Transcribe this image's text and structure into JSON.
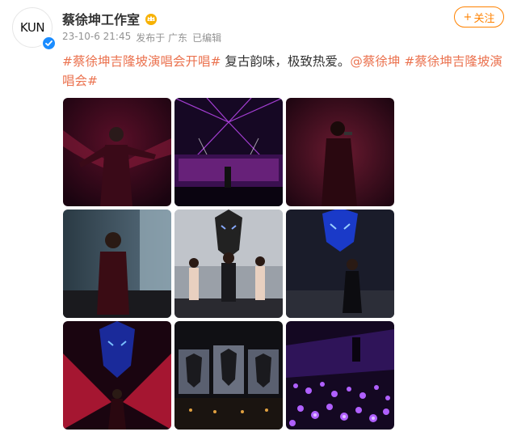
{
  "user": {
    "name": "蔡徐坤工作室",
    "avatar_text": "KUN",
    "badge_icon": "crown-icon",
    "verified_icon": "verified-check-icon"
  },
  "meta": {
    "time": "23-10-6 21:45",
    "source": "发布于 广东",
    "edited": "已编辑"
  },
  "follow_button": {
    "plus": "+",
    "label": "关注"
  },
  "post": {
    "tag1": "#蔡徐坤吉隆坡演唱会开唱#",
    "text": " 复古韵味，极致热爱。",
    "mention": "@蔡徐坤",
    "tag2": " #蔡徐坤吉隆坡演唱会#"
  },
  "photos": [
    {
      "name": "photo-1",
      "desc": "performer in sequin suit, red backdrop"
    },
    {
      "name": "photo-2",
      "desc": "stage with purple lasers"
    },
    {
      "name": "photo-3",
      "desc": "performer singing, dark red stage"
    },
    {
      "name": "photo-4",
      "desc": "performer in front of big screen"
    },
    {
      "name": "photo-5",
      "desc": "dancers with wolf screen"
    },
    {
      "name": "photo-6",
      "desc": "performer with blue wolf screen"
    },
    {
      "name": "photo-7",
      "desc": "red stage with blue wolf screen"
    },
    {
      "name": "photo-8",
      "desc": "wide stage with dark screens"
    },
    {
      "name": "photo-9",
      "desc": "purple crowd lightsticks"
    }
  ],
  "colors": {
    "accent": "#ff8200",
    "link": "#eb7350",
    "meta": "#939393",
    "verified": "#1a8cff"
  }
}
